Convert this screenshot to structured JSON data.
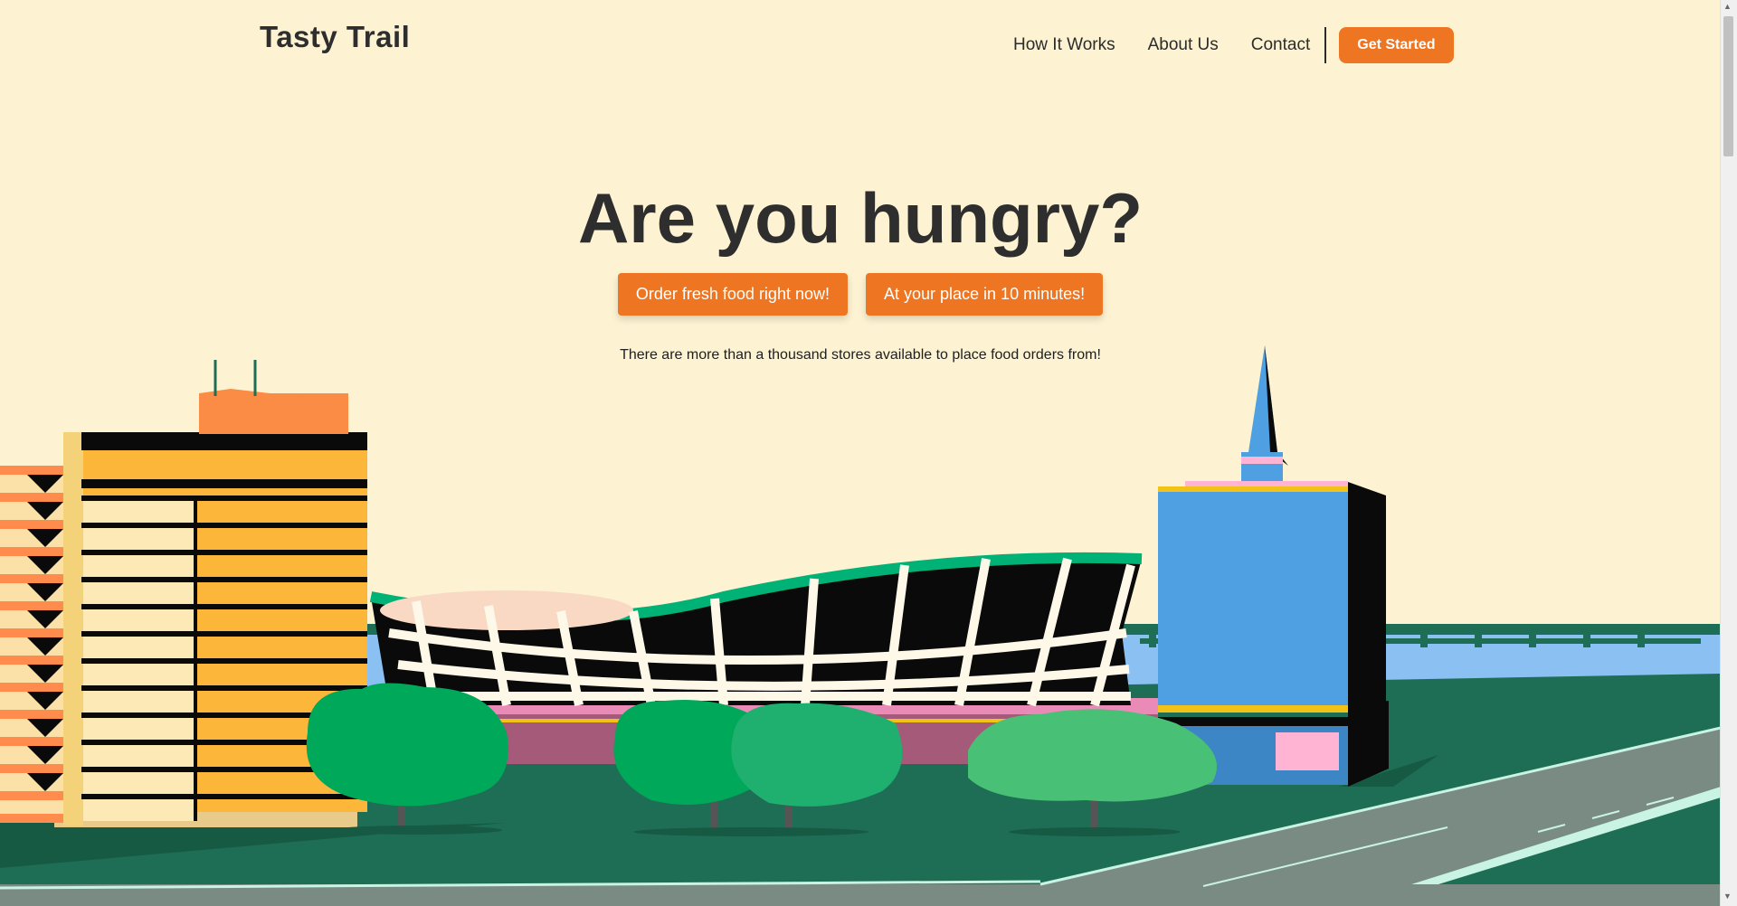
{
  "brand": {
    "name": "Tasty Trail"
  },
  "nav": {
    "items": [
      {
        "label": "How It Works"
      },
      {
        "label": "About Us"
      },
      {
        "label": "Contact"
      }
    ],
    "cta_label": "Get Started"
  },
  "hero": {
    "title": "Are you hungry?",
    "pill_left": "Order fresh food right now!",
    "pill_right": "At your place in 10 minutes!",
    "subtitle": "There are more than a thousand stores available to place food orders from!"
  },
  "colors": {
    "background": "#fdf3d2",
    "accent": "#ee7623",
    "text": "#2e2e2e"
  },
  "icons": {
    "scroll_up": "triangle-up-icon",
    "scroll_down": "triangle-down-icon"
  }
}
